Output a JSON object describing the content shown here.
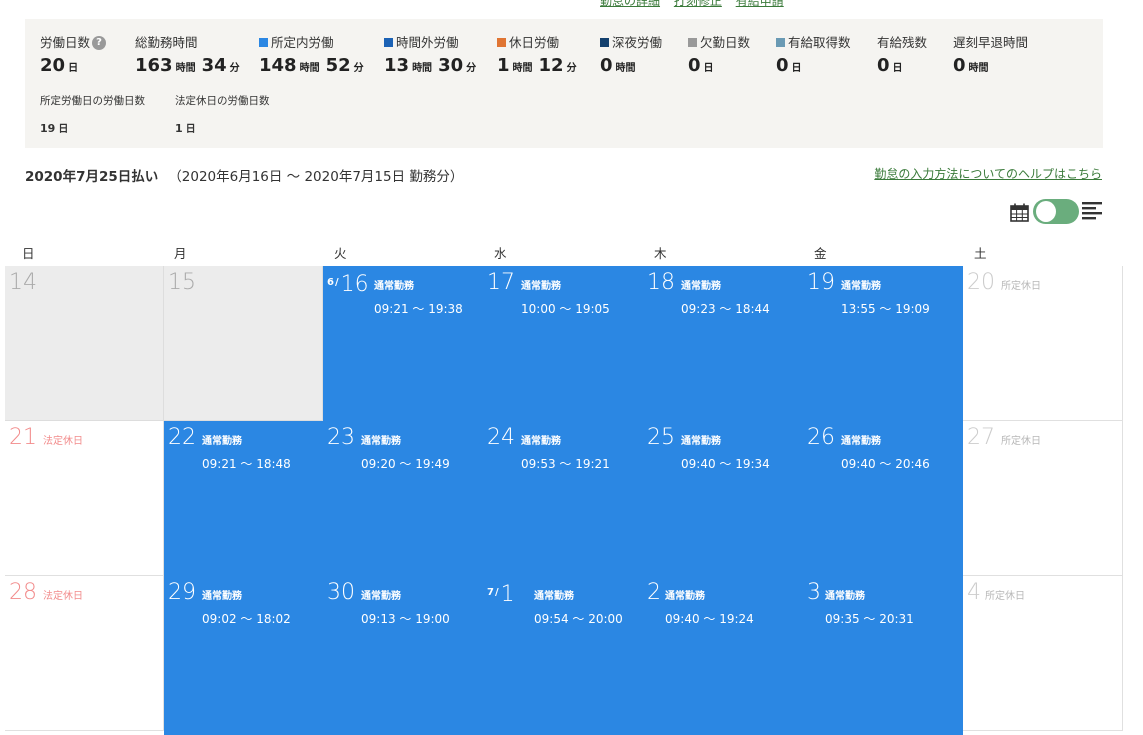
{
  "top_links": [
    "勤怠の詳細",
    "打刻修正",
    "有給申請"
  ],
  "colors": {
    "shotei_nai": "#2b87e3",
    "jikangai": "#1c62b5",
    "kyujitsu": "#e07533",
    "shinya": "#14406e",
    "kekkin": "#999999",
    "yukyu": "#6a9ab4",
    "work_cell": "#2b87e3",
    "holiday_red": "#f28c8c",
    "toggle": "#6aad7d",
    "link": "#3a7a3a"
  },
  "summary": {
    "workdays": {
      "label": "労働日数",
      "value": "20",
      "unit": "日"
    },
    "total_hours": {
      "label": "総勤務時間",
      "h": "163",
      "h_unit": "時間",
      "m": "34",
      "m_unit": "分"
    },
    "shotei_nai": {
      "label": "所定内労働",
      "h": "148",
      "h_unit": "時間",
      "m": "52",
      "m_unit": "分"
    },
    "jikangai": {
      "label": "時間外労働",
      "h": "13",
      "h_unit": "時間",
      "m": "30",
      "m_unit": "分"
    },
    "kyujitsu": {
      "label": "休日労働",
      "h": "1",
      "h_unit": "時間",
      "m": "12",
      "m_unit": "分"
    },
    "shinya": {
      "label": "深夜労働",
      "h": "0",
      "h_unit": "時間"
    },
    "kekkin": {
      "label": "欠勤日数",
      "value": "0",
      "unit": "日"
    },
    "yukyu_shutoku": {
      "label": "有給取得数",
      "value": "0",
      "unit": "日"
    },
    "yukyu_zan": {
      "label": "有給残数",
      "value": "0",
      "unit": "日"
    },
    "chikoku": {
      "label": "遅刻早退時間",
      "h": "0",
      "h_unit": "時間"
    },
    "shotei_days": {
      "label": "所定労働日の労働日数",
      "value": "19",
      "unit": "日"
    },
    "hotei_days": {
      "label": "法定休日の労働日数",
      "value": "1",
      "unit": "日"
    }
  },
  "period": {
    "pay": "2020年7月25日払い",
    "range": "（2020年6月16日 〜 2020年7月15日 勤務分）"
  },
  "help_link": "勤怠の入力方法についてのヘルプはこちら",
  "weekdays": [
    "日",
    "月",
    "火",
    "水",
    "木",
    "金",
    "土"
  ],
  "weeks": [
    [
      {
        "kind": "out",
        "day": "14"
      },
      {
        "kind": "out",
        "day": "15"
      },
      {
        "kind": "work",
        "month": "6",
        "day": "16",
        "tag": "通常勤務",
        "time": "09:21 〜 19:38"
      },
      {
        "kind": "work",
        "day": "17",
        "tag": "通常勤務",
        "time": "10:00 〜 19:05"
      },
      {
        "kind": "work",
        "day": "18",
        "tag": "通常勤務",
        "time": "09:23 〜 18:44"
      },
      {
        "kind": "work",
        "day": "19",
        "tag": "通常勤務",
        "time": "13:55 〜 19:09"
      },
      {
        "kind": "holiday",
        "day": "20",
        "tag": "所定休日",
        "tone": "grey"
      }
    ],
    [
      {
        "kind": "holiday",
        "day": "21",
        "tag": "法定休日",
        "tone": "red"
      },
      {
        "kind": "work",
        "day": "22",
        "tag": "通常勤務",
        "time": "09:21 〜 18:48"
      },
      {
        "kind": "work",
        "day": "23",
        "tag": "通常勤務",
        "time": "09:20 〜 19:49"
      },
      {
        "kind": "work",
        "day": "24",
        "tag": "通常勤務",
        "time": "09:53 〜 19:21"
      },
      {
        "kind": "work",
        "day": "25",
        "tag": "通常勤務",
        "time": "09:40 〜 19:34"
      },
      {
        "kind": "work",
        "day": "26",
        "tag": "通常勤務",
        "time": "09:40 〜 20:46"
      },
      {
        "kind": "holiday",
        "day": "27",
        "tag": "所定休日",
        "tone": "grey"
      }
    ],
    [
      {
        "kind": "holiday",
        "day": "28",
        "tag": "法定休日",
        "tone": "red"
      },
      {
        "kind": "work",
        "day": "29",
        "tag": "通常勤務",
        "time": "09:02 〜 18:02"
      },
      {
        "kind": "work",
        "day": "30",
        "tag": "通常勤務",
        "time": "09:13 〜 19:00"
      },
      {
        "kind": "work",
        "month": "7",
        "day": "1",
        "tag": "通常勤務",
        "time": "09:54 〜 20:00"
      },
      {
        "kind": "work",
        "day": "2",
        "tag": "通常勤務",
        "time": "09:40 〜 19:24"
      },
      {
        "kind": "work",
        "day": "3",
        "tag": "通常勤務",
        "time": "09:35 〜 20:31"
      },
      {
        "kind": "holiday",
        "day": "4",
        "tag": "所定休日",
        "tone": "grey"
      }
    ]
  ],
  "icons": {
    "help": "question-circle-icon",
    "calendar": "calendar-icon",
    "list": "list-lines-icon"
  }
}
